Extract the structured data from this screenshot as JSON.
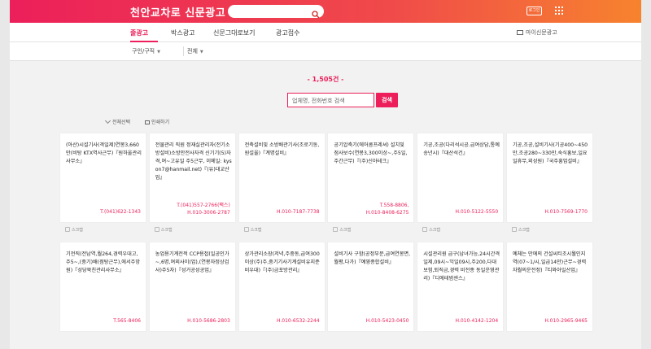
{
  "header": {
    "logo_left": "천안",
    "logo_bold": "교차로",
    "logo_right": "신문광고",
    "login": "로그인"
  },
  "nav": {
    "items": [
      "줄광고",
      "박스광고",
      "신문그대로보기",
      "광고접수"
    ],
    "right": "마이신문광고"
  },
  "filters": {
    "category": "구인/구직",
    "region": "전체"
  },
  "listing": {
    "count": "- 1,505건 -",
    "search_placeholder": "업체명, 전화번호 검색",
    "search_button": "검색",
    "select_all": "전체선택",
    "print": "인쇄하기"
  },
  "cards": [
    {
      "text": "(아산)시설기사(격일제)연봉3,660만(비탕 KTX역사근무)『원하울관리사무소』",
      "phone1": "T.(041)622-1343",
      "phone2": ""
    },
    {
      "text": "전물관리 직원 정재실관리자(전기소방설비)소방안전사자격 신기기(5)자격,여~고유일 주5근무, 이메일: kyson7@hanmail.net)『(유)대교산업』",
      "phone1": "T.(041)557-2766(팩스)",
      "phone2": "H.010-3006-2787"
    },
    {
      "text": "전축설비및 소방배관기사(조로기동,원설울)『계명설비』",
      "phone1": "H.010-7187-7738",
      "phone2": ""
    },
    {
      "text": "공기압축기(에어콤프레셔) 설치및 점사보수(연봉3,300이상~,주5일,주간근무)『(주)신아테크』",
      "phone1": "T.558-8806,",
      "phone2": "H.010-8408-6275"
    },
    {
      "text": "기공,조공(다리석시공.급여상담,통예 송년시)『대산석건』",
      "phone1": "H.010-5122-5550",
      "phone2": ""
    },
    {
      "text": "기공,조공,설비기사(기공400~450만,조공280~330만,숙식홍보,일요일휴무,외성원)『국주흥업설비』",
      "phone1": "H.010-7569-1770",
      "phone2": ""
    },
    {
      "text": "기전직(전남역,월264,경력우대고,주5~,(중기)배(점탕근무),에서주망원)『성당북친관리사무소』",
      "phone1": "T.565-8406",
      "phone2": ""
    },
    {
      "text": "농업용기계전적 CCP용접(일공인가~,6명,여외사이(업),(연봉자정상검사)주5자)『성거공성공업』",
      "phone1": "H.010-5686-2803",
      "phone2": ""
    },
    {
      "text": "상가관리소장(저녁,주중동,급여300이상(주)주,중기기사기계설비유지준비우대)『(주)금포방관리』",
      "phone1": "H.010-6532-2244",
      "phone2": ""
    },
    {
      "text": "설비기사 구함(공정부문,급여연봉면,월평,다가)『예영종합설비』",
      "phone1": "H.010-5423-0450",
      "phone2": ""
    },
    {
      "text": "시설관리원 급구(남녀가능,24시간격일제,09시~익일09시,주200,다대보험,퇴직금,경력 비전종 동일운영관리)『디에테범센스』",
      "phone1": "H.010-4142-1204",
      "phone2": ""
    },
    {
      "text": "예체는 만에의 건설씨티조시월인지역(07~1/시,일급14만)근무~경력자월의운전정)『티와아일산업』",
      "phone1": "H.010-2965-9465",
      "phone2": ""
    }
  ],
  "card_footer": "스크랩",
  "colors": {
    "brand": "#ec1f5a",
    "gradient_end": "#f7832e"
  }
}
